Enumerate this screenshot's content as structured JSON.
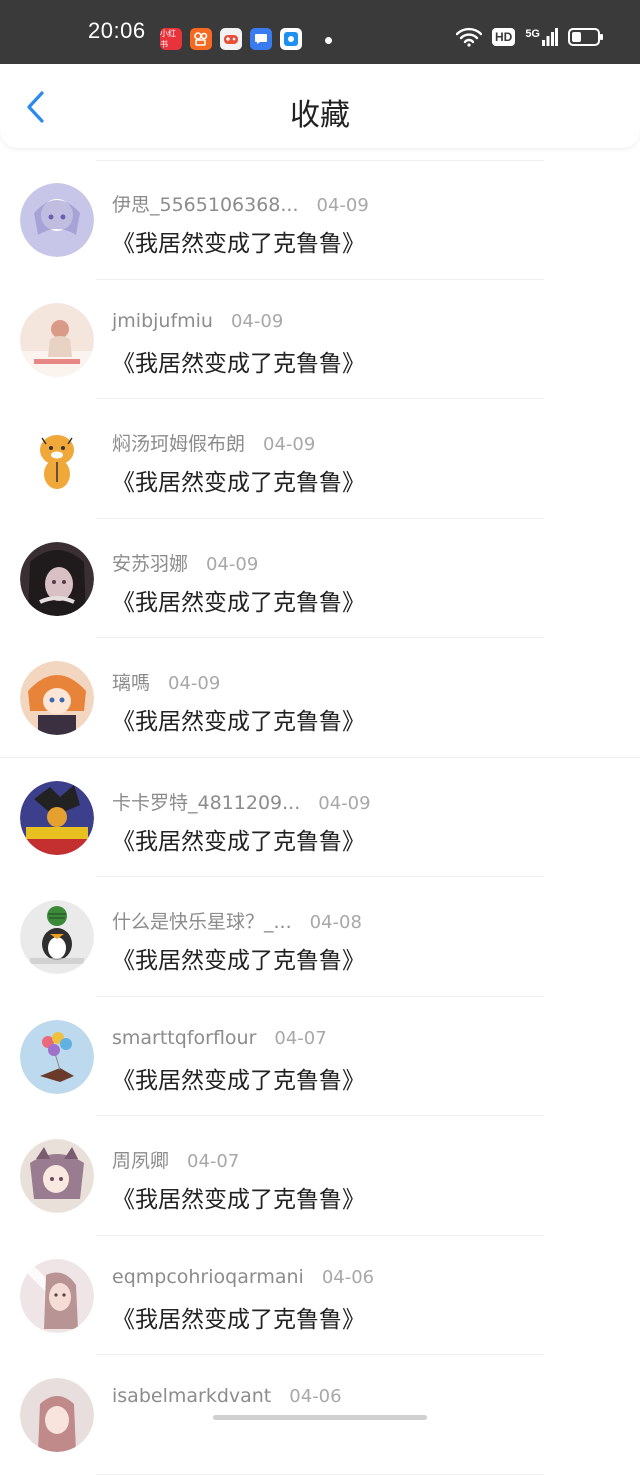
{
  "status_bar": {
    "time": "20:06",
    "hd_label": "HD",
    "network_label": "5G",
    "app_icons": [
      {
        "name": "xiaohongshu-icon",
        "color": "#e8333a",
        "label": "小红书"
      },
      {
        "name": "kuaishou-icon",
        "color": "#f56a22",
        "label": ""
      },
      {
        "name": "game-icon",
        "color": "#f2f2f2",
        "label": ""
      },
      {
        "name": "chat-icon",
        "color": "#3b7bf0",
        "label": ""
      },
      {
        "name": "camera-app-icon",
        "color": "#1f8ff0",
        "label": ""
      }
    ]
  },
  "header": {
    "title": "收藏"
  },
  "colors": {
    "accent": "#2a8af0",
    "text_primary": "#222222",
    "text_secondary": "#8c8c8c"
  },
  "items": [
    {
      "user": "伊思_5565106368...",
      "date": "04-09",
      "title": "《我居然变成了克鲁鲁》",
      "avatar": {
        "bg": "#c8c6e8",
        "fg": "#8e86c8"
      }
    },
    {
      "user": "jmibjufmiu",
      "date": "04-09",
      "title": "《我居然变成了克鲁鲁》",
      "avatar": {
        "bg": "#f4e6dc",
        "fg": "#d99b87"
      }
    },
    {
      "user": "焖汤珂姆假布朗",
      "date": "04-09",
      "title": "《我居然变成了克鲁鲁》",
      "avatar": {
        "bg": "#ffffff",
        "fg": "#f0a83a"
      }
    },
    {
      "user": "安苏羽娜",
      "date": "04-09",
      "title": "《我居然变成了克鲁鲁》",
      "avatar": {
        "bg": "#3a3034",
        "fg": "#d8c0c4"
      }
    },
    {
      "user": "璃嗎",
      "date": "04-09",
      "title": "《我居然变成了克鲁鲁》",
      "avatar": {
        "bg": "#f3d6c0",
        "fg": "#e8843a"
      }
    },
    {
      "user": "卡卡罗特_4811209...",
      "date": "04-09",
      "title": "《我居然变成了克鲁鲁》",
      "avatar": {
        "bg": "#3b3f8c",
        "fg": "#e6a030"
      }
    },
    {
      "user": "什么是快乐星球？_...",
      "date": "04-08",
      "title": "《我居然变成了克鲁鲁》",
      "avatar": {
        "bg": "#eaeaea",
        "fg": "#2f2f2f"
      }
    },
    {
      "user": "smarttqforflour",
      "date": "04-07",
      "title": "《我居然变成了克鲁鲁》",
      "avatar": {
        "bg": "#bcd9ee",
        "fg": "#e96a7a"
      }
    },
    {
      "user": "周夙卿",
      "date": "04-07",
      "title": "《我居然变成了克鲁鲁》",
      "avatar": {
        "bg": "#e9e0da",
        "fg": "#9a7c90"
      }
    },
    {
      "user": "eqmpcohrioqarmani",
      "date": "04-06",
      "title": "《我居然变成了克鲁鲁》",
      "avatar": {
        "bg": "#efe4e6",
        "fg": "#b89494"
      }
    },
    {
      "user": "isabelmarkdvant",
      "date": "04-06",
      "title": "",
      "avatar": {
        "bg": "#e8dede",
        "fg": "#c08a8a"
      }
    }
  ]
}
